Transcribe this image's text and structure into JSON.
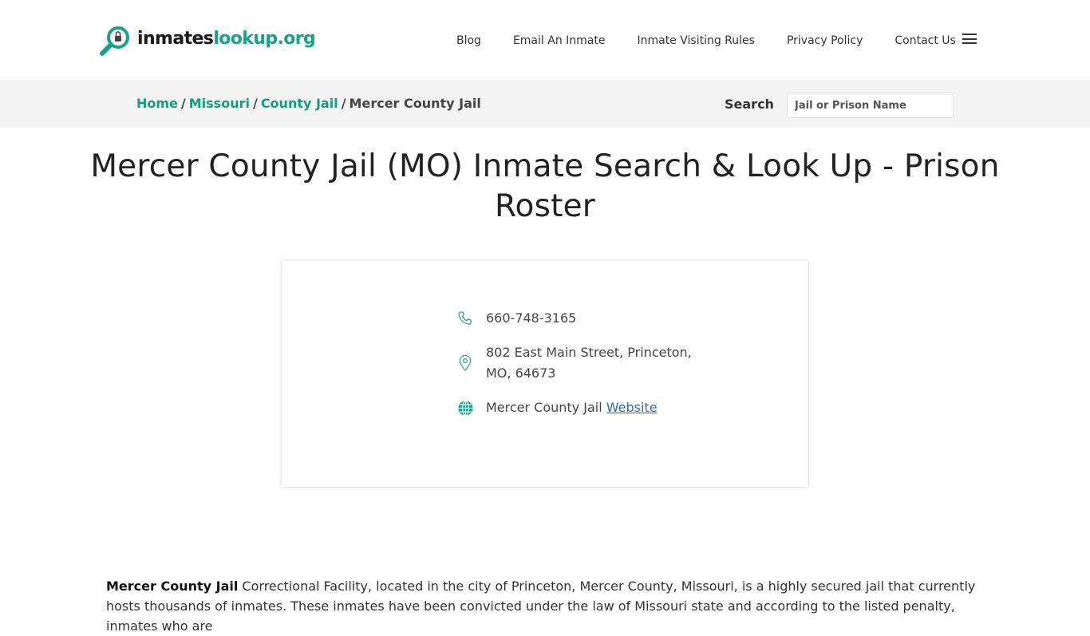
{
  "logo": {
    "part1": "inmates",
    "part2": "lookup.org"
  },
  "nav": {
    "items": [
      "Blog",
      "Email An Inmate",
      "Inmate Visiting Rules",
      "Privacy Policy",
      "Contact Us"
    ],
    "menu_icon": "hamburger-menu-icon"
  },
  "breadcrumb": {
    "home": "Home",
    "state": "Missouri",
    "type": "County Jail",
    "current": "Mercer County Jail",
    "separator": "/"
  },
  "search": {
    "label": "Search",
    "placeholder": "Jail or Prison Name"
  },
  "page": {
    "title": "Mercer County Jail (MO) Inmate Search & Look Up - Prison Roster"
  },
  "card": {
    "phone": "660-748-3165",
    "address": "802 East Main Street, Princeton, MO, 64673",
    "website_prefix": "Mercer County Jail",
    "website_link": "Website"
  },
  "intro": {
    "bold": "Mercer County Jail",
    "text": " Correctional Facility, located in the city of Princeton, Mercer County, Missouri, is a highly secured jail that currently hosts thousands of inmates. These inmates have been convicted under the law of Missouri state and according to the listed penalty, inmates who are"
  },
  "colors": {
    "accent": "#1aa18a",
    "link": "#2f6ca8",
    "crumb_bg": "#f3f3f3"
  }
}
